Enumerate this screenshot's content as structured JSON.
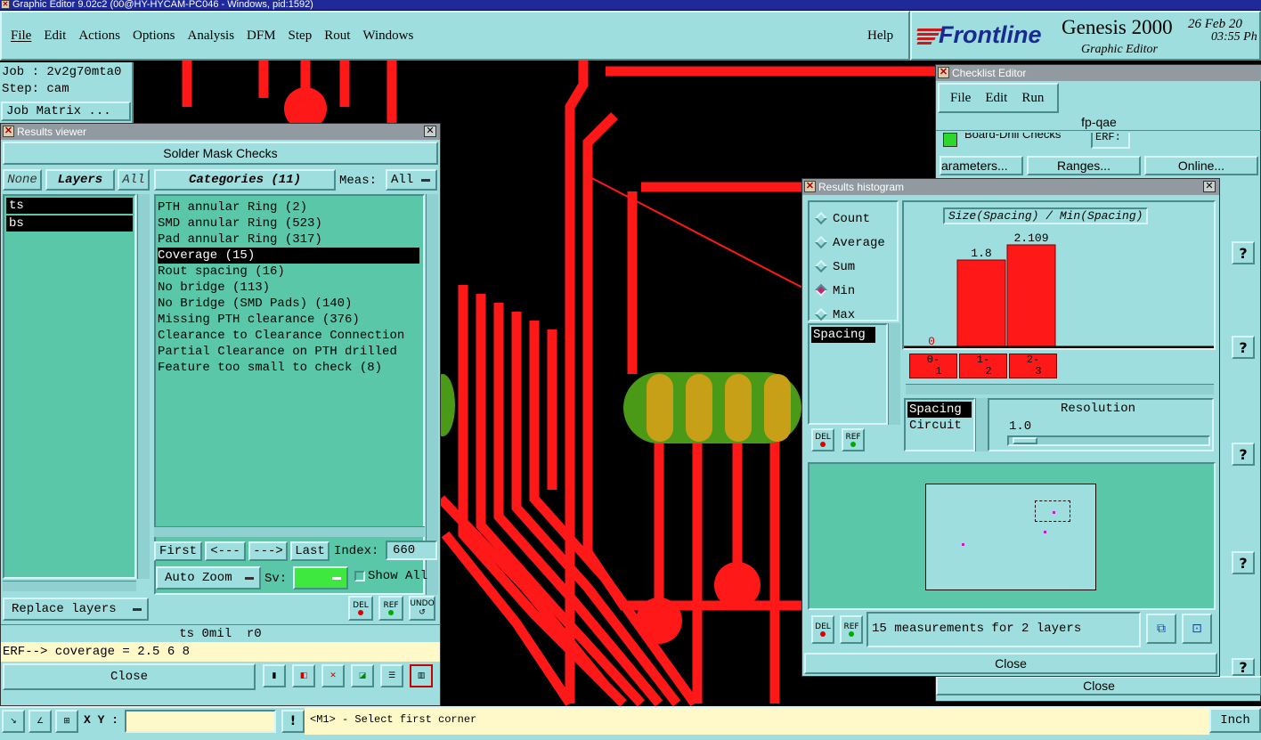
{
  "app": {
    "title": "Graphic Editor 9.02c2 (00@HY-HYCAM-PC046 - Windows, pid:1592)",
    "menu": [
      "File",
      "Edit",
      "Actions",
      "Options",
      "Analysis",
      "DFM",
      "Step",
      "Rout",
      "Windows"
    ],
    "help": "Help",
    "logo": "Frontline",
    "product": "Genesis 2000",
    "subtitle": "Graphic Editor",
    "date": "26 Feb 20",
    "time": "03:55 Ph"
  },
  "job": {
    "job_label": "Job : 2v2g70mta0",
    "step_label": "Step: cam",
    "matrix_button": "Job Matrix ..."
  },
  "results_viewer": {
    "title": "Results viewer",
    "header": "Solder Mask Checks",
    "none": "None",
    "layers": "Layers",
    "all": "All",
    "layer_list": [
      "ts",
      "bs"
    ],
    "categories_label": "Categories (11)",
    "meas_label": "Meas:",
    "meas_value": "All",
    "categories": [
      "PTH annular Ring (2)",
      "SMD annular Ring (523)",
      "Pad annular Ring (317)",
      "Coverage (15)",
      "Rout spacing (16)",
      "No bridge (113)",
      "No Bridge (SMD Pads) (140)",
      "Missing PTH clearance (376)",
      "Clearance to Clearance Connection",
      "Partial Clearance on PTH drilled",
      "Feature too small to check (8)"
    ],
    "first": "First",
    "prev": "<---",
    "next": "--->",
    "last": "Last",
    "index_label": "Index:",
    "index_value": "660",
    "auto_zoom": "Auto Zoom",
    "sv_label": "Sv:",
    "show_all": "Show All",
    "replace_layers": "Replace layers",
    "del": "DEL",
    "ref": "REF",
    "undo": "UNDO",
    "status_line": "ts 0mil  r0",
    "erf_line": "ERF--> coverage = 2.5 6 8",
    "close": "Close"
  },
  "checklist": {
    "title": "Checklist Editor",
    "menu": [
      "File",
      "Edit",
      "Run"
    ],
    "name": "fp-qae",
    "row_text": "Board-Drill Checks",
    "erf": "ERF:",
    "buttons": [
      "arameters...",
      "Ranges...",
      "Online..."
    ],
    "close": "Close"
  },
  "histogram": {
    "title": "Results histogram",
    "modes": [
      {
        "label": "Count",
        "on": false
      },
      {
        "label": "Average",
        "on": false
      },
      {
        "label": "Sum",
        "on": false
      },
      {
        "label": "Min",
        "on": true
      },
      {
        "label": "Max",
        "on": false
      }
    ],
    "chart_title": "Size(Spacing) / Min(Spacing)",
    "bars": [
      {
        "range_top": "0-",
        "range_bottom": "1",
        "value": 0,
        "label": "0"
      },
      {
        "range_top": "1-",
        "range_bottom": "2",
        "value": 1.8,
        "label": "1.8"
      },
      {
        "range_top": "2-",
        "range_bottom": "3",
        "value": 2.109,
        "label": "2.109"
      }
    ],
    "measure_list": [
      "Spacing"
    ],
    "type_list": [
      "Spacing",
      "Circuit"
    ],
    "resolution_label": "Resolution",
    "resolution_value": "1.0",
    "measurements_text": "15 measurements for 2 layers",
    "close": "Close"
  },
  "bottom": {
    "xy_label": "X Y :",
    "prompt": "<M1> - Select first corner",
    "units": "Inch"
  },
  "colors": {
    "panel": "#9edede",
    "list_bg": "#5ac8a8",
    "trace": "#ff1818",
    "canvas": "#000000"
  }
}
